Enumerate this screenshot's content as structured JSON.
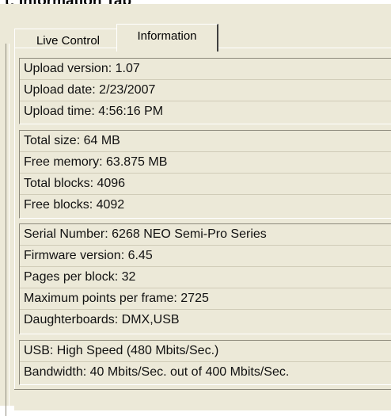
{
  "caption": "t: Information Tab",
  "tabs": {
    "live_control": "Live Control",
    "information": "Information"
  },
  "groups": {
    "upload": [
      "Upload version: 1.07",
      "Upload date: 2/23/2007",
      "Upload time: 4:56:16 PM"
    ],
    "memory": [
      "Total size: 64 MB",
      "Free memory: 63.875 MB",
      "Total blocks: 4096",
      "Free blocks: 4092"
    ],
    "device": [
      "Serial Number: 6268 NEO Semi-Pro Series",
      "Firmware version: 6.45",
      "Pages per block: 32",
      "Maximum points per frame: 2725",
      "Daughterboards: DMX,USB"
    ],
    "usb": [
      "USB: High Speed (480 Mbits/Sec.)",
      "Bandwidth: 40 Mbits/Sec. out of 400 Mbits/Sec."
    ]
  },
  "colors": {
    "face": "#ece9d8",
    "shadow": "#8d8a7c",
    "highlight": "#ffffff"
  }
}
